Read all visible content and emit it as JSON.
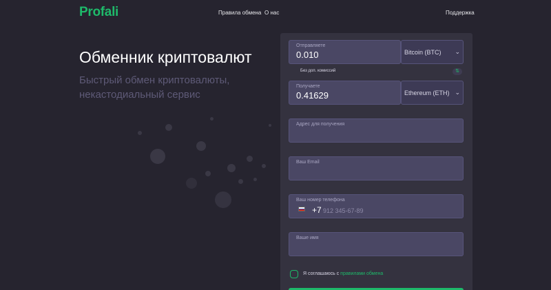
{
  "header": {
    "logo": "Profali",
    "nav": {
      "rules": "Правила обмена",
      "about": "О нас",
      "support": "Поддержка"
    }
  },
  "hero": {
    "title": "Обменник криптовалют",
    "subtitle": "Быстрый обмен криптовалюты, некастодиальный сервис"
  },
  "form": {
    "send": {
      "label": "Отправляете",
      "value": "0.010",
      "currency": "Bitcoin (BTC)"
    },
    "commission_note": "Без доп. комиссий",
    "swap_icon": "swap-arrows-icon",
    "receive": {
      "label": "Получаете",
      "value": "0.41629",
      "currency": "Ethereum (ETH)"
    },
    "address": {
      "label": "Адрес для получения",
      "value": ""
    },
    "email": {
      "label": "Ваш Email",
      "value": ""
    },
    "phone": {
      "label": "Ваш номер телефона",
      "code": "+7",
      "placeholder": "912 345-67-89",
      "flag": "russia-flag-icon"
    },
    "name": {
      "label": "Ваше имя",
      "value": ""
    },
    "agree": {
      "text": "Я соглашаюсь с ",
      "link": "правилами обмена"
    }
  },
  "colors": {
    "background": "#26242f",
    "card": "#34323f",
    "field": "#4a4764",
    "accent": "#1eb96a",
    "muted_text": "#5e5a77"
  }
}
